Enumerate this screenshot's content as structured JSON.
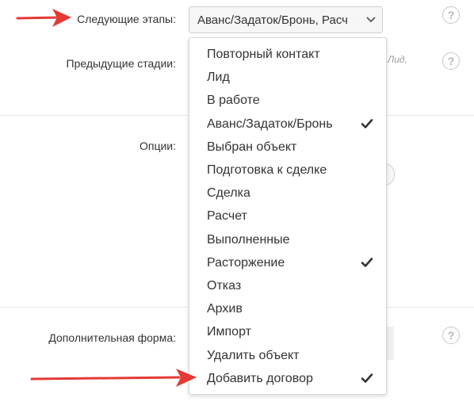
{
  "form": {
    "next_stages_label": "Следующие этапы:",
    "next_stages_value": "Аванс/Задаток/Бронь, Расч",
    "prev_stages_label": "Предыдущие стадии:",
    "prev_stages_partial_text": "Лид,",
    "options_label": "Опции:",
    "extra_form_label": "Дополнительная форма:",
    "help_glyph": "?"
  },
  "dropdown": {
    "options": [
      {
        "label": "Повторный контакт",
        "checked": false
      },
      {
        "label": "Лид",
        "checked": false
      },
      {
        "label": "В работе",
        "checked": false
      },
      {
        "label": "Аванс/Задаток/Бронь",
        "checked": true
      },
      {
        "label": "Выбран объект",
        "checked": false
      },
      {
        "label": "Подготовка к сделке",
        "checked": false
      },
      {
        "label": "Сделка",
        "checked": false
      },
      {
        "label": "Расчет",
        "checked": false
      },
      {
        "label": "Выполненные",
        "checked": false
      },
      {
        "label": "Расторжение",
        "checked": true
      },
      {
        "label": "Отказ",
        "checked": false
      },
      {
        "label": "Архив",
        "checked": false
      },
      {
        "label": "Импорт",
        "checked": false
      },
      {
        "label": "Удалить объект",
        "checked": false
      },
      {
        "label": "Добавить договор",
        "checked": true
      }
    ]
  },
  "colors": {
    "annotation_arrow": "#e53935",
    "check": "#333333"
  },
  "icons": [
    "help-icon",
    "chevron-down-icon",
    "checkmark-icon",
    "annotation-arrow"
  ]
}
